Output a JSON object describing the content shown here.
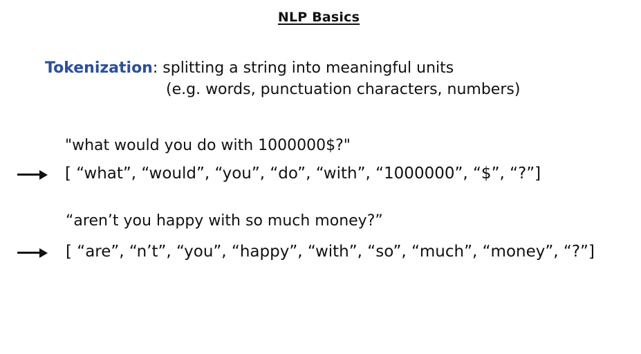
{
  "slide": {
    "title": "NLP Basics",
    "definition": {
      "term": "Tokenization",
      "text": ": splitting a string into meaningful units",
      "text_line2": "(e.g. words, punctuation characters, numbers)"
    },
    "examples": [
      {
        "input": "\"what would you do with 1000000$?\"",
        "tokens": "[ “what”, “would”, “you”, “do”, “with”, “1000000”, “$”, “?”]"
      },
      {
        "input": "“aren’t you happy with so much money?”",
        "tokens": "[ “are”, “n’t”, “you”, “happy”, “with”, “so”, “much”, “money”, “?”]"
      }
    ]
  },
  "colors": {
    "term": "#2a4f9c",
    "text": "#111111",
    "background": "#ffffff"
  },
  "icons": {
    "arrow": "right-arrow-icon"
  }
}
